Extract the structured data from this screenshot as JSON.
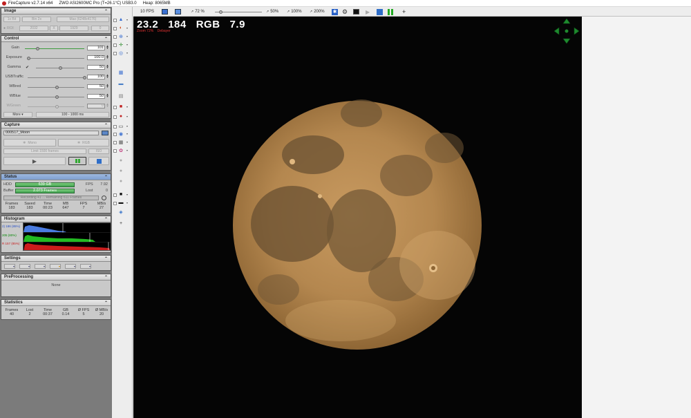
{
  "window": {
    "title": "FireCapture v2.7.14 x64",
    "camera": "ZWO ASI2600MC Pro (T=26.1°C) USB3.0",
    "heap": "Heap: 8065MB"
  },
  "image_section": {
    "title": "Image",
    "bin_left": "1x Bit",
    "bin_select": "Bin 2x",
    "max_res": "Max (6248x4176)",
    "roi_label": "ROI",
    "roi_x": "2032",
    "roi_x_btn": "X",
    "roi_y": "1929",
    "roi_extra": "0"
  },
  "control": {
    "title": "Control",
    "rows": [
      {
        "label": "Gain",
        "value": "101"
      },
      {
        "label": "Exposure",
        "value": "100.0"
      },
      {
        "label": "Gamma",
        "value": "50"
      },
      {
        "label": "USBTraffic",
        "value": "100"
      },
      {
        "label": "WBred",
        "value": "50"
      },
      {
        "label": "WBlue",
        "value": "50"
      },
      {
        "label": "WGreen",
        "value": "0"
      }
    ],
    "more": "More",
    "range": "100 - 1000 ms"
  },
  "capture": {
    "title": "Capture",
    "filename": "000517_Moon",
    "mode_left": "Mono",
    "mode_right": "RGB",
    "limit": "Limit 1500 frames",
    "limit_right": "ISO"
  },
  "status": {
    "title": "Status",
    "hdd_label": "HDD",
    "hdd_value": "639 GB",
    "fps_label": "FPS",
    "fps_value": "7.92",
    "buffer_label": "Buffer",
    "buffer_value": "2.073 Frames",
    "lost_label": "Lost",
    "lost_value": "0",
    "recording": "Recording 41 ... Remaining 611 Frames",
    "headers": [
      "Frames",
      "Saved",
      "Time",
      "MB",
      "FPS",
      "MB/s"
    ],
    "values": [
      "183",
      "183",
      "00:23",
      "647",
      "7",
      "27"
    ]
  },
  "histogram": {
    "title": "Histogram",
    "red_label": "R 157 (85%)",
    "green_label": "205 (80%)",
    "blue_label": "2) 186 (85%)"
  },
  "settings": {
    "title": "Settings"
  },
  "preprocessing": {
    "title": "PreProcessing",
    "value": "None"
  },
  "statistics": {
    "title": "Statistics",
    "headers": [
      "Frames",
      "Lost",
      "Time",
      "GB",
      "Ø FPS",
      "Ø MB/s"
    ],
    "values": [
      "40",
      "2",
      "00:37",
      "0.14",
      "5",
      "20"
    ]
  },
  "toolbar": {
    "fps": "10 FPS",
    "zoom_fit": "72 %",
    "zoom_50": "50%",
    "zoom_100": "100%",
    "zoom_200": "200%",
    "plus": "+"
  },
  "overlay": {
    "big": "23.2   184   RGB   7.9",
    "small": "Zoom 72%    Debayer"
  },
  "colors": {
    "green_bar": "#3f9f4f",
    "accent_red": "#c02020",
    "moon": "#b58a50",
    "background": "#050505"
  }
}
